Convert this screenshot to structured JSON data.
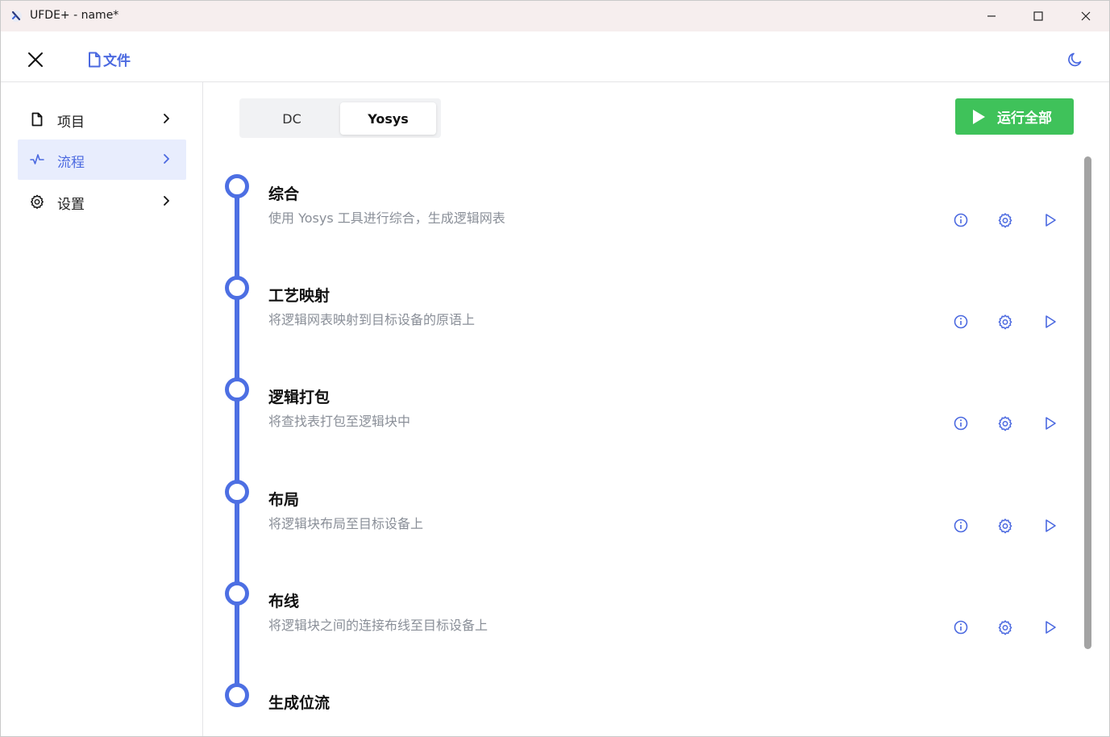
{
  "window": {
    "title": "UFDE+ - name*"
  },
  "header": {
    "file_menu_label": "文件",
    "icons": {
      "close": "close-icon",
      "file": "file-icon",
      "theme": "moon-icon"
    }
  },
  "sidebar": {
    "items": [
      {
        "label": "项目",
        "icon": "file-icon",
        "active": false
      },
      {
        "label": "流程",
        "icon": "activity-icon",
        "active": true
      },
      {
        "label": "设置",
        "icon": "gear-icon",
        "active": false
      }
    ]
  },
  "tabs": {
    "items": [
      {
        "label": "DC",
        "selected": false
      },
      {
        "label": "Yosys",
        "selected": true
      }
    ]
  },
  "run_all": {
    "label": "运行全部"
  },
  "steps": [
    {
      "title": "综合",
      "description": "使用 Yosys 工具进行综合，生成逻辑网表"
    },
    {
      "title": "工艺映射",
      "description": "将逻辑网表映射到目标设备的原语上"
    },
    {
      "title": "逻辑打包",
      "description": "将查找表打包至逻辑块中"
    },
    {
      "title": "布局",
      "description": "将逻辑块布局至目标设备上"
    },
    {
      "title": "布线",
      "description": "将逻辑块之间的连接布线至目标设备上"
    },
    {
      "title": "生成位流",
      "description": ""
    }
  ],
  "colors": {
    "accent": "#4d6fe3",
    "run_button": "#3fc25a",
    "active_nav_bg": "#e8edfd",
    "description_text": "#8a8f98"
  }
}
